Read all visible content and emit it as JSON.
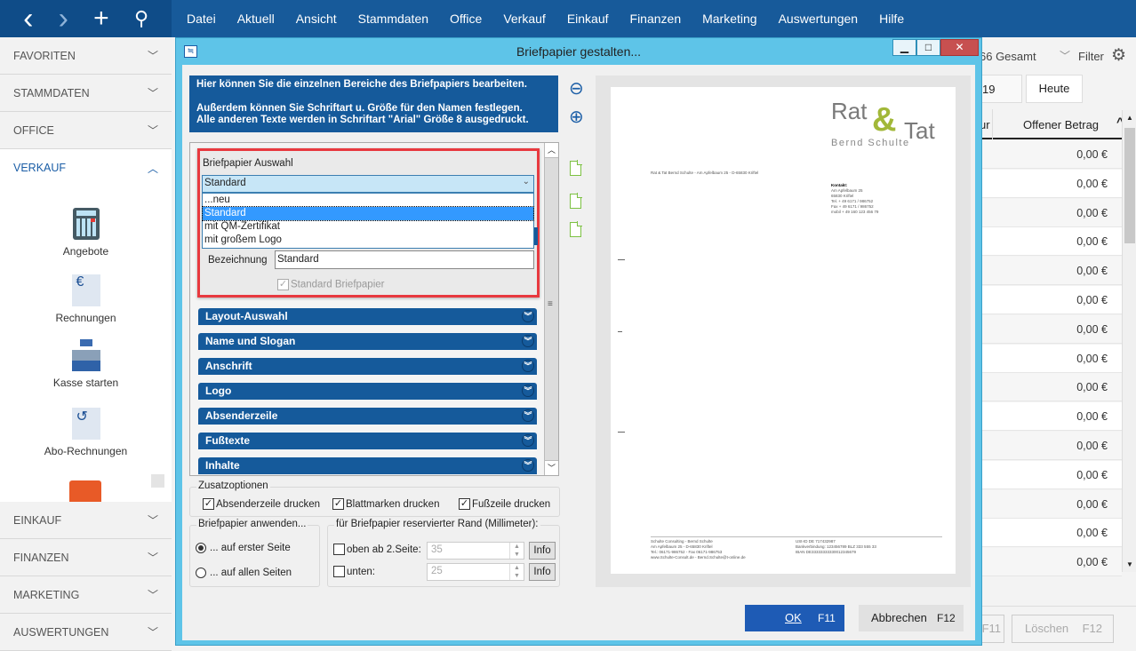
{
  "nav": {
    "back": "‹",
    "forward": "›",
    "add": "+",
    "search": "⚲"
  },
  "menu": [
    "Datei",
    "Aktuell",
    "Ansicht",
    "Stammdaten",
    "Office",
    "Verkauf",
    "Einkauf",
    "Finanzen",
    "Marketing",
    "Auswertungen",
    "Hilfe"
  ],
  "sidebar": {
    "top_items": [
      {
        "label": "FAVORITEN"
      },
      {
        "label": "STAMMDATEN"
      },
      {
        "label": "OFFICE"
      },
      {
        "label": "VERKAUF"
      }
    ],
    "tiles": [
      {
        "label": "Angebote"
      },
      {
        "label": "Rechnungen"
      },
      {
        "label": "Kasse starten"
      },
      {
        "label": "Abo-Rechnungen"
      }
    ],
    "bottom_items": [
      {
        "label": "EINKAUF"
      },
      {
        "label": "FINANZEN"
      },
      {
        "label": "MARKETING"
      },
      {
        "label": "AUSWERTUNGEN"
      }
    ]
  },
  "background": {
    "count": "66 Gesamt",
    "filter": "Filter",
    "date_partial": "19",
    "today": "Heute",
    "col_partial": "ur",
    "col_open_amount": "Offener Betrag",
    "rows": [
      "0,00 €",
      "0,00 €",
      "0,00 €",
      "0,00 €",
      "0,00 €",
      "0,00 €",
      "0,00 €",
      "0,00 €",
      "0,00 €",
      "0,00 €",
      "0,00 €",
      "0,00 €",
      "0,00 €",
      "0,00 €",
      "0,00 €"
    ],
    "btn_partial_key": "F11",
    "delete_label": "Löschen",
    "delete_key": "F12"
  },
  "dialog": {
    "title": "Briefpapier gestalten...",
    "info_line1": "Hier können Sie die einzelnen Bereiche des Briefpapiers bearbeiten.",
    "info_line2": "Außerdem können Sie Schriftart u. Größe für den Namen festlegen.",
    "info_line3": "Alle anderen Texte werden in Schriftart \"Arial\" Größe 8 ausgedruckt.",
    "selection_label": "Briefpapier Auswahl",
    "selected": "Standard",
    "options": [
      "...neu",
      "Standard",
      "mit QM-Zertifikat",
      "mit großem Logo"
    ],
    "name_label": "Bezeichnung",
    "name_value": "Standard",
    "default_checkbox": "Standard Briefpapier",
    "sections": [
      "Layout-Auswahl",
      "Name und Slogan",
      "Anschrift",
      "Logo",
      "Absenderzeile",
      "Fußtexte",
      "Inhalte"
    ],
    "extra_options_title": "Zusatzoptionen",
    "extra_options": [
      {
        "label": "Absenderzeile drucken",
        "checked": true
      },
      {
        "label": "Blattmarken drucken",
        "checked": true
      },
      {
        "label": "Fußzeile drucken",
        "checked": true
      }
    ],
    "apply_title": "Briefpapier anwenden...",
    "apply_options": [
      {
        "label": "... auf erster Seite",
        "selected": true
      },
      {
        "label": "... auf allen Seiten",
        "selected": false
      }
    ],
    "margin_title": "für Briefpapier reservierter Rand (Millimeter):",
    "margin_top_label": "oben ab 2.Seite:",
    "margin_top_value": "35",
    "margin_bottom_label": "unten:",
    "margin_bottom_value": "25",
    "info_button": "Info",
    "ok_label": "OK",
    "ok_key": "F11",
    "cancel_label": "Abbrechen",
    "cancel_key": "F12"
  },
  "preview": {
    "logo_rat": "Rat",
    "logo_amp": "&",
    "logo_tat": "Tat",
    "logo_name": "Bernd Schulte",
    "sender_line": "Rat & Tat Bernd Schulte - Am Apfelbaum 25 - D-65830 Kriftel",
    "contact": [
      "Kontakt:",
      "Am Apfelbaum 25",
      "65830 Kriftel",
      "Tel. + 49 6171 / 986752",
      "Fax + 49 6171 / 986752",
      "mobil + 49 160 123 456 79"
    ],
    "footer_left": [
      "Schulte Consulting - Bernd Schulte",
      "Am Apfelbaum 25 - D-65830 Kriftel",
      "Tel.: 06171-986752 - Fax 06171-986753",
      "www.Schulte-Consult.de - Bernd.Schulte@t-online.de"
    ],
    "footer_right": [
      "USt-ID DE 717432987",
      "Bankverbindung: 123456789 BLZ 333 555 33",
      "IBAN DE33333333330012345679"
    ]
  },
  "colors": {
    "brand_blue": "#155a9b",
    "dialog_border": "#5ec4e8",
    "highlight": "#e8393f",
    "logo_green": "#a2b839",
    "ok_blue": "#1e5bb5"
  }
}
